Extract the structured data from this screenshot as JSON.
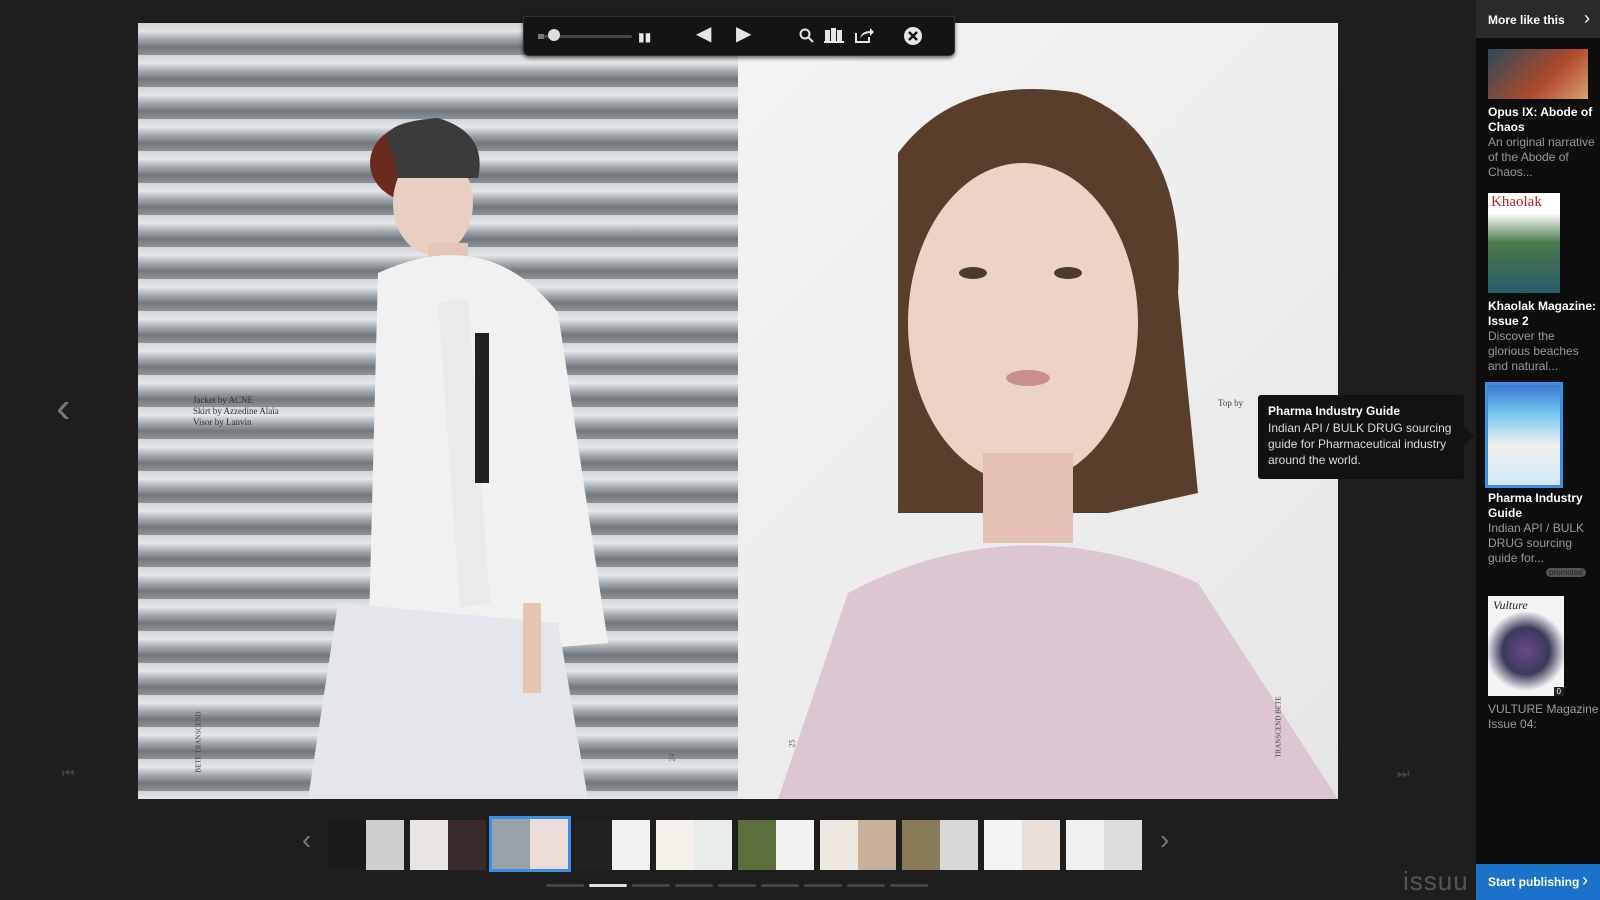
{
  "viewer": {
    "left_page": {
      "credits": [
        "Jacket by ACNE",
        "Skirt by Azzedine Alaïa",
        "Visor by Lanvin"
      ],
      "page_number": "24",
      "vertical_text": "BETE TRANSCEND"
    },
    "right_page": {
      "page_number": "25",
      "credit_partial": "Top by",
      "vertical_text": "TRANSCEND BETE"
    }
  },
  "toolbar": {
    "icons": [
      "zoom-slider",
      "thumbnail-grid-icon",
      "previous-page-icon",
      "next-page-icon",
      "search-icon",
      "library-icon",
      "share-icon",
      "close-icon"
    ],
    "zoom_level": 0.14
  },
  "side_panel": {
    "header_label": "More like this",
    "items": [
      {
        "title": "Opus IX: Abode of Chaos",
        "desc": "An original narrative of the Abode of Chaos..."
      },
      {
        "title": "Khaolak Magazine: Issue 2",
        "desc": "Discover the glorious beaches and natural...",
        "cover_text": "Khaolak"
      },
      {
        "title": "Pharma Industry Guide",
        "desc": "Indian API / BULK DRUG sourcing guide for...",
        "badge": "promoted"
      },
      {
        "title": "VULTURE Magazine Issue 04:",
        "desc": "",
        "cover_text": "Vulture",
        "count": "0"
      }
    ],
    "start_label": "Start publishing"
  },
  "tooltip": {
    "title": "Pharma Industry Guide",
    "desc": "Indian API / BULK DRUG sourcing guide for Pharmaceutical industry around the world."
  },
  "thumbnails": {
    "count": 10,
    "active_index": 2
  },
  "page_dots": {
    "count": 9,
    "active_index": 1
  },
  "brand": "issuu",
  "colors": {
    "accent": "#1a73c8",
    "active_outline": "#3a8ee6",
    "background": "#1e1e1e"
  }
}
